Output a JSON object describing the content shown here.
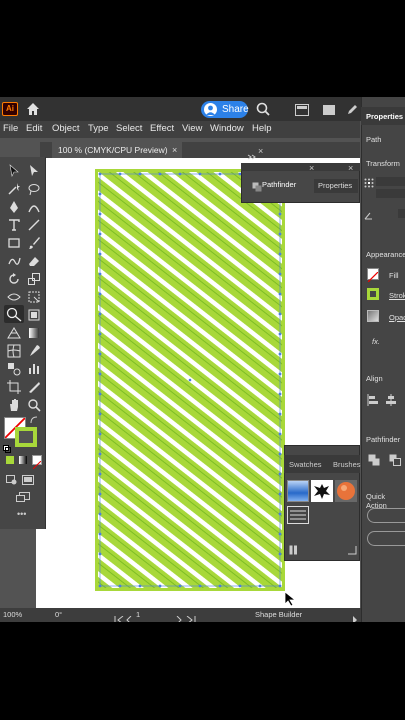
{
  "topbar": {
    "app_logo": "Ai",
    "share_label": "Share"
  },
  "menu": [
    "File",
    "Edit",
    "Object",
    "Type",
    "Select",
    "Effect",
    "View",
    "Window",
    "Help"
  ],
  "document": {
    "tab_title": "100 % (CMYK/CPU Preview)",
    "close_glyph": "×"
  },
  "pathfinder": {
    "tab_label": "Pathfinder",
    "second_tab": "Properties"
  },
  "swatches": {
    "tab_label": "Swatches",
    "second_tab": "Brushes"
  },
  "properties": {
    "title": "Properties",
    "path_label": "Path",
    "transform_label": "Transform",
    "appearance_label": "Appearance",
    "fill_label": "Fill",
    "stroke_label": "Stroke",
    "opacity_label": "Opacity",
    "fx_label": "fx.",
    "align_label": "Align",
    "pathfinder_label": "Pathfinder",
    "quick_actions_label": "Quick Action"
  },
  "statusbar": {
    "zoom": "100%",
    "rotation": "0°",
    "artboard_number": "1",
    "tool_name": "Shape Builder"
  },
  "colors": {
    "artwork_green": "#a8d83a",
    "stripe_white": "#ffffff",
    "selection_blue": "#4a7fe0",
    "accent": "#2c81e8"
  }
}
